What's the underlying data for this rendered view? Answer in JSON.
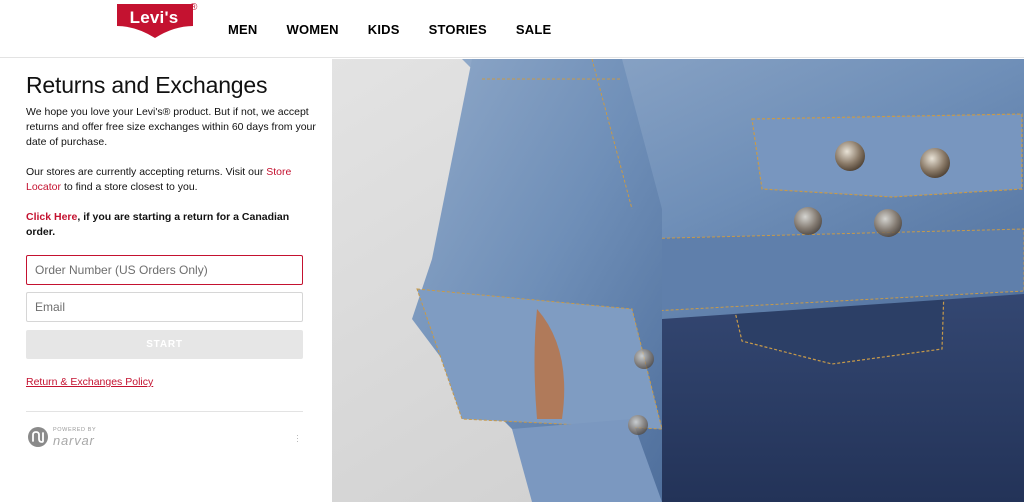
{
  "brand": {
    "logo_text": "Levi's",
    "reg_mark": "®"
  },
  "nav": {
    "items": [
      "MEN",
      "WOMEN",
      "KIDS",
      "STORIES",
      "SALE"
    ]
  },
  "returns": {
    "title": "Returns and Exchanges",
    "intro": "We hope you love your Levi's® product. But if not, we accept returns and offer free size exchanges within 60 days from your date of purchase.",
    "stores_text_before": "Our stores are currently accepting returns. Visit our ",
    "store_locator_link": "Store Locator",
    "stores_text_after": " to find a store closest to you.",
    "canada_link": "Click Here",
    "canada_text": ", if you are starting a return for a Canadian order.",
    "order_placeholder": "Order Number (US Orders Only)",
    "email_placeholder": "Email",
    "start_label": "START",
    "policy_link": "Return & Exchanges Policy",
    "powered_by": "POWERED BY",
    "powered_brand": "narvar"
  },
  "colors": {
    "brand_red": "#c41230",
    "button_disabled": "#e6e6e6",
    "denim_dark": "#2c3f66",
    "denim_light": "#6f8fb8"
  },
  "icons": {
    "powered_logo": "narvar-logo-icon",
    "more": "more-vertical-icon"
  },
  "hero": {
    "alt": "Denim jacket and jeans"
  }
}
